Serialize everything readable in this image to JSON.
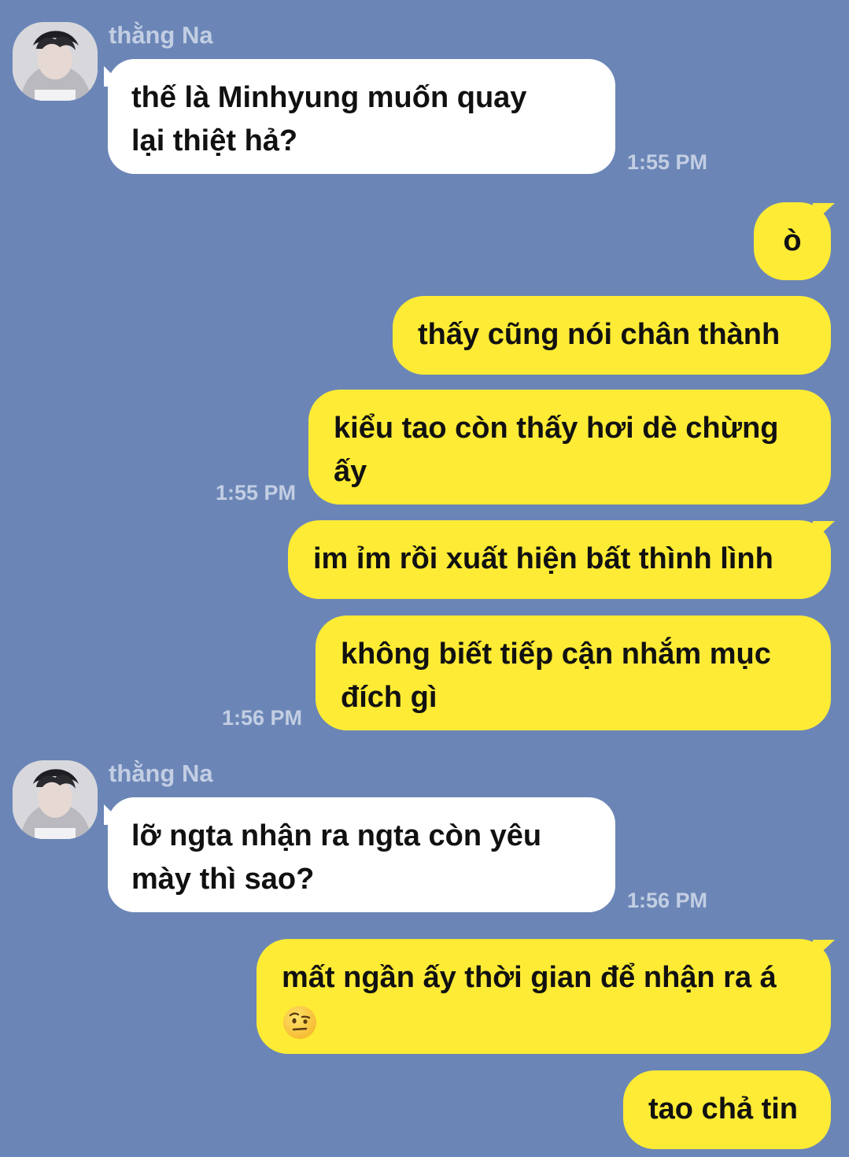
{
  "contact": {
    "name": "thằng Na"
  },
  "messages": [
    {
      "side": "in",
      "lines": [
        "thế là Minhyung muốn quay",
        "lại thiệt hả?"
      ],
      "time": "1:55 PM"
    },
    {
      "side": "out",
      "lines": [
        "ò"
      ]
    },
    {
      "side": "out",
      "lines": [
        "thấy cũng nói chân thành"
      ]
    },
    {
      "side": "out",
      "lines": [
        "kiểu tao còn thấy hơi dè chừng",
        "ấy"
      ],
      "time": "1:55 PM"
    },
    {
      "side": "out",
      "lines": [
        "im ỉm rồi xuất hiện bất thình lình"
      ]
    },
    {
      "side": "out",
      "lines": [
        "không biết tiếp cận nhắm mục",
        "đích gì"
      ],
      "time": "1:56 PM"
    },
    {
      "side": "in",
      "lines": [
        "lỡ ngta nhận ra ngta còn yêu",
        "mày thì sao?"
      ],
      "time": "1:56 PM"
    },
    {
      "side": "out",
      "lines": [
        "mất ngần ấy thời gian để nhận ra á"
      ],
      "emoji": "raised-eyebrow-emoji"
    },
    {
      "side": "out",
      "lines": [
        "tao chả tin"
      ]
    }
  ],
  "colors": {
    "background": "#6b86b6",
    "incoming_bubble": "#ffffff",
    "outgoing_bubble": "#feeb35",
    "meta_text": "#c3cee3"
  }
}
